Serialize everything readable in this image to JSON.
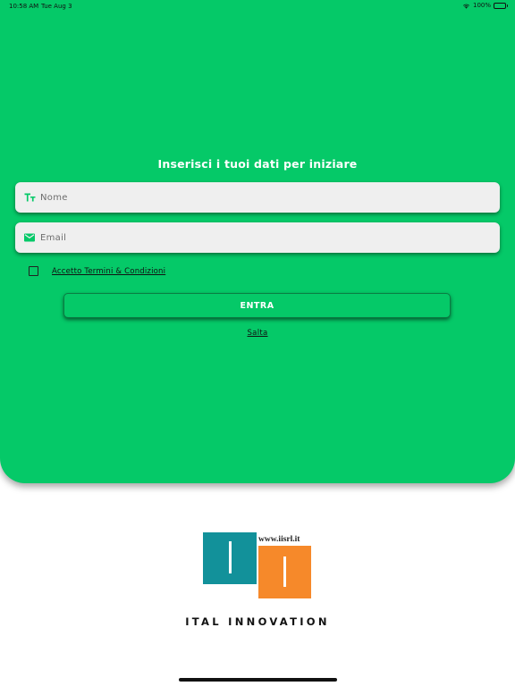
{
  "status_bar": {
    "time": "10:58 AM",
    "date": "Tue Aug 3",
    "battery": "100%"
  },
  "form": {
    "headline": "Inserisci i tuoi dati per iniziare",
    "name_placeholder": "Nome",
    "email_placeholder": "Email",
    "terms_label": "Accetto Termini & Condizioni",
    "terms_checked": false,
    "submit_label": "ENTRA",
    "skip_label": "Salta"
  },
  "branding": {
    "logo_url_text": "www.iisrl.it",
    "company_name": "ITAL INNOVATION"
  },
  "colors": {
    "accent_green": "#05c968",
    "field_background": "#efefef",
    "logo_teal": "#12919a",
    "logo_orange": "#f6892a"
  },
  "icons": {
    "name_field": "text-size-icon",
    "email_field": "envelope-icon"
  }
}
